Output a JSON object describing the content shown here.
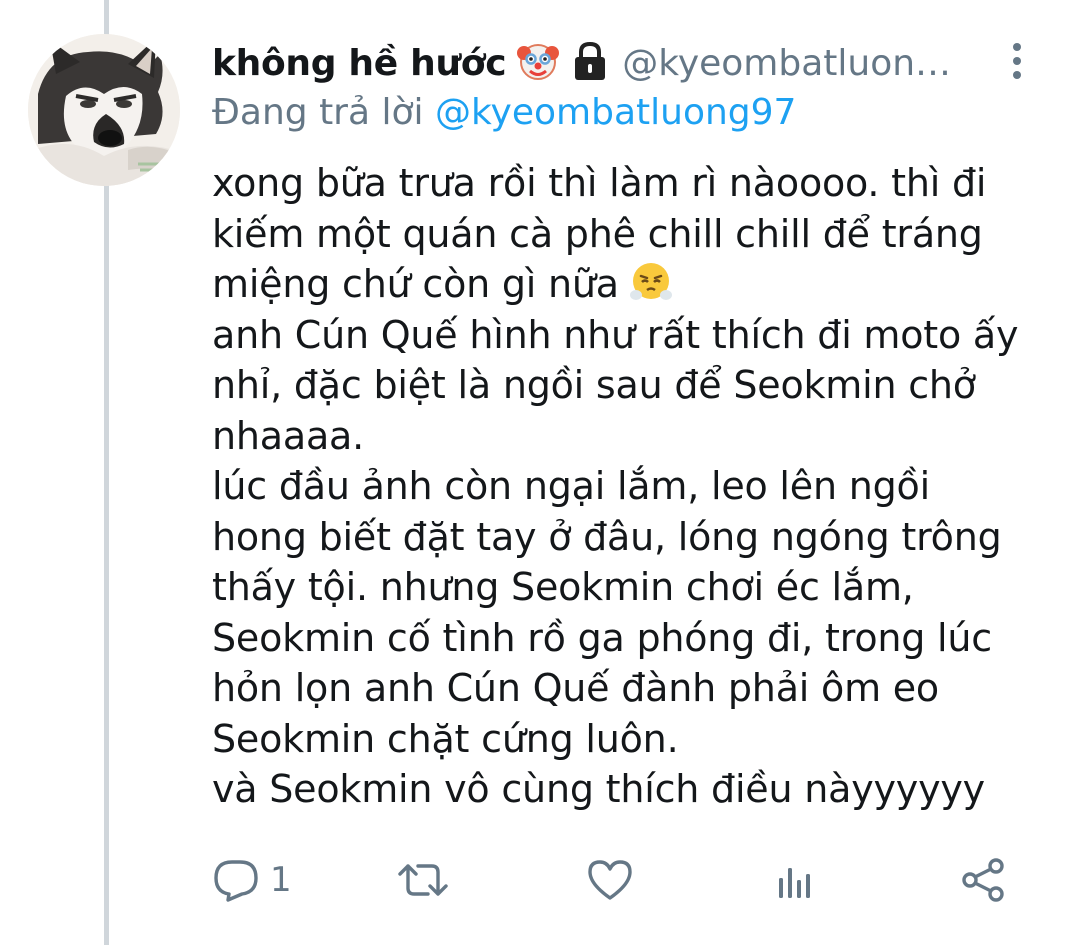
{
  "tweet": {
    "display_name": "không hề hước",
    "emojis": [
      "clown-face-emoji",
      "lock-icon"
    ],
    "handle": "@kyeombatluon…",
    "reply_prefix": "Đang trả lời",
    "reply_mention": "@kyeombatluong97",
    "text_lines": [
      "xong bữa trưa rồi thì làm rì nàoooo. thì đi",
      "kiếm một quán cà phê chill chill để tráng",
      "miệng chứ còn gì nữa",
      "anh Cún Quế hình như rất thích đi moto ấy",
      "nhỉ, đặc biệt là ngồi sau để Seokmin chở",
      "nhaaaa.",
      "lúc đầu ảnh còn ngại lắm, leo lên ngồi",
      "hong biết đặt tay ở đâu, lóng ngóng trông",
      "thấy tội. nhưng Seokmin chơi éc lắm,",
      "Seokmin cố tình rồ ga phóng đi, trong lúc",
      "hỏn lọn anh Cún Quế đành phải ôm eo",
      "Seokmin chặt cứng luôn.",
      "và Seokmin vô cùng thích điều nàyyyyyy"
    ],
    "inline_emoji": "face-with-steam-from-nose-emoji",
    "reply_count": "1"
  },
  "actions": {
    "reply_icon": "reply-icon",
    "retweet_icon": "retweet-icon",
    "like_icon": "heart-icon",
    "analytics_icon": "analytics-icon",
    "share_icon": "share-icon"
  },
  "colors": {
    "text": "#14171a",
    "secondary": "#657786",
    "link": "#1da1f2",
    "thread_line": "#d0d6db"
  }
}
